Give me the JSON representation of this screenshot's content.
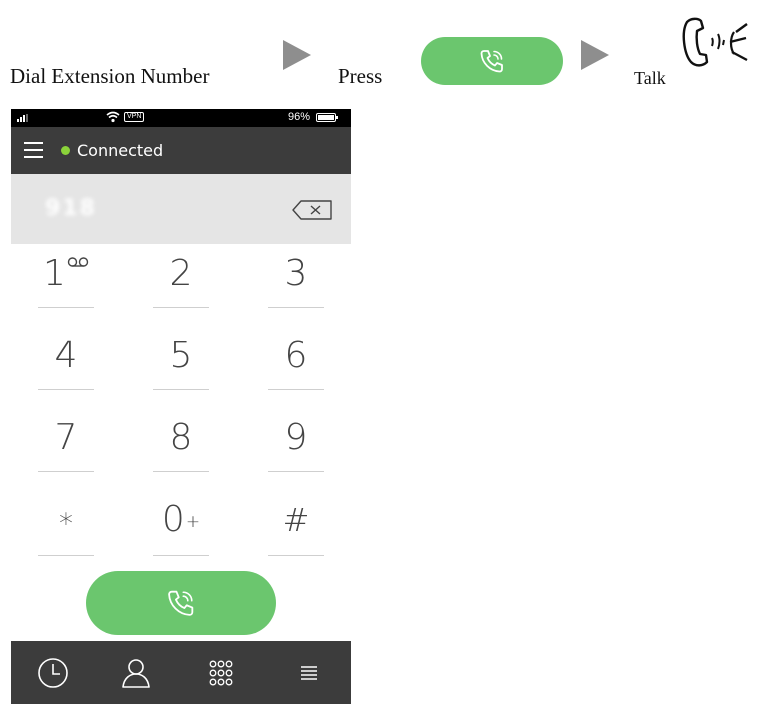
{
  "instructions": {
    "step1": "Dial Extension Number",
    "step2": "Press",
    "step3": "Talk"
  },
  "status_bar": {
    "vpn": "VPN",
    "battery": "96%"
  },
  "header": {
    "status": "Connected"
  },
  "dial_entry": {
    "value": "918"
  },
  "keypad": {
    "keys": [
      {
        "digit": "1",
        "sub": "∞"
      },
      {
        "digit": "2",
        "sub": ""
      },
      {
        "digit": "3",
        "sub": ""
      },
      {
        "digit": "4",
        "sub": ""
      },
      {
        "digit": "5",
        "sub": ""
      },
      {
        "digit": "6",
        "sub": ""
      },
      {
        "digit": "7",
        "sub": ""
      },
      {
        "digit": "8",
        "sub": ""
      },
      {
        "digit": "9",
        "sub": ""
      },
      {
        "digit": "*",
        "sub": ""
      },
      {
        "digit": "0",
        "sub": "+"
      },
      {
        "digit": "#",
        "sub": ""
      }
    ]
  },
  "icons": {
    "voicemail": "voicemail-icon",
    "call": "phone-call-icon",
    "backspace": "backspace-icon",
    "menu": "hamburger-icon",
    "talk": "handset-speech-icon",
    "tabs": [
      "history-icon",
      "contacts-icon",
      "dialpad-icon",
      "menu-icon"
    ]
  },
  "colors": {
    "accent_green": "#6bc66e",
    "status_dot": "#8bd33a",
    "bar_dark": "#3c3c3c",
    "entry_bg": "#e5e5e5"
  }
}
